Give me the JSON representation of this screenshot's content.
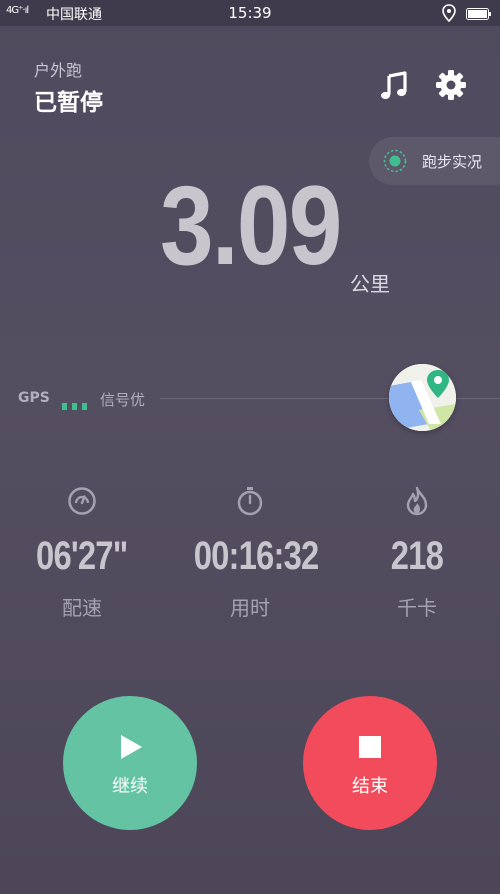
{
  "status_bar": {
    "signal": "4G⁺·ıl",
    "carrier": "中国联通",
    "time": "15:39",
    "location_icon": "location-pin-icon",
    "battery_icon": "battery-icon"
  },
  "header": {
    "activity_type": "户外跑",
    "run_status": "已暂停",
    "music_icon": "music-note-icon",
    "settings_icon": "gear-icon"
  },
  "live_status": {
    "label": "跑步实况",
    "icon": "radar-icon",
    "accent_color": "#3fbf8f"
  },
  "distance": {
    "value": "3.09",
    "unit": "公里"
  },
  "gps": {
    "label": "GPS",
    "signal_text": "信号优",
    "bars": 3,
    "bar_color": "#3fbf8f",
    "map_icon": "map-icon"
  },
  "stats": [
    {
      "icon": "speedometer-icon",
      "value": "06'27\"",
      "label": "配速"
    },
    {
      "icon": "stopwatch-icon",
      "value": "00:16:32",
      "label": "用时"
    },
    {
      "icon": "flame-icon",
      "value": "218",
      "label": "千卡"
    }
  ],
  "actions": {
    "continue": {
      "label": "继续",
      "icon": "play-icon",
      "color": "#63c3a2"
    },
    "end": {
      "label": "结束",
      "icon": "stop-icon",
      "color": "#f24b5c"
    }
  }
}
